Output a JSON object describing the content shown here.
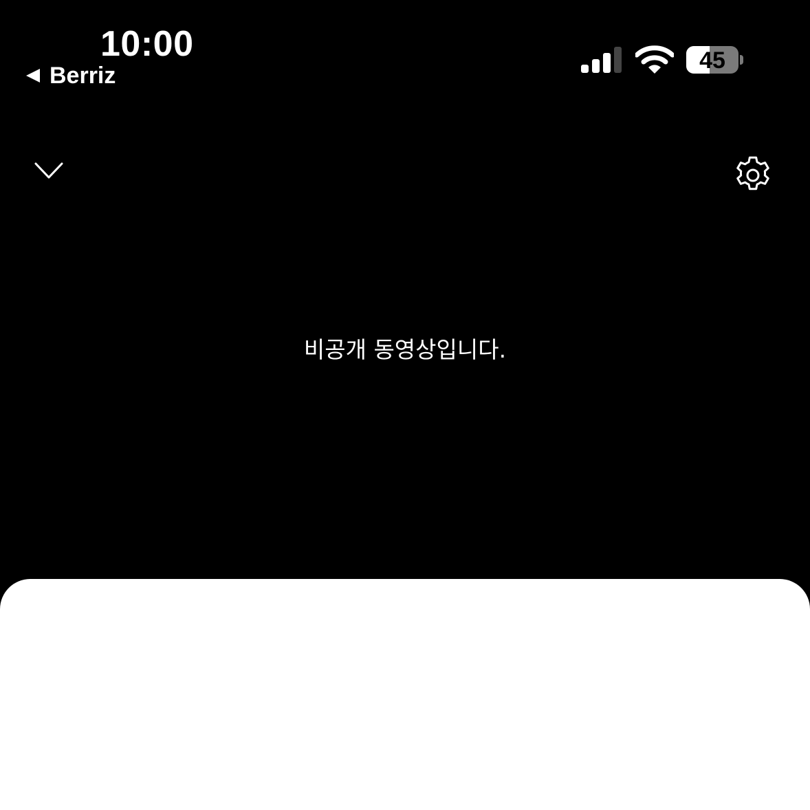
{
  "status_bar": {
    "time": "10:00",
    "back_app_label": "Berriz",
    "battery_level": "45",
    "battery_fraction": 0.45,
    "signal_bars_active": 3,
    "signal_bars_total": 4,
    "icons": [
      "back-arrow-icon",
      "signal-icon",
      "wifi-icon",
      "battery-icon"
    ]
  },
  "player": {
    "collapse_icon": "chevron-down-icon",
    "settings_icon": "gear-icon",
    "message": "비공개 동영상입니다."
  },
  "colors": {
    "background": "#000000",
    "foreground": "#ffffff",
    "sheet": "#ffffff",
    "battery_track": "#7a7a7a"
  }
}
